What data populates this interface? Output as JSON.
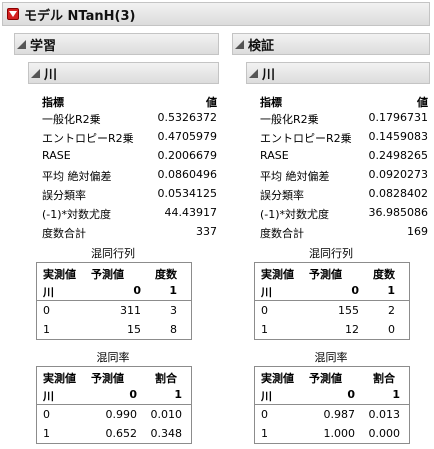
{
  "title": "モデル NTanH(3)",
  "panels": [
    {
      "section_label": "学習",
      "sub_label": "川",
      "stats_header": {
        "metric": "指標",
        "value": "値"
      },
      "stats": [
        {
          "label": "一般化R2乗",
          "value": "0.5326372"
        },
        {
          "label": "エントロピーR2乗",
          "value": "0.4705979"
        },
        {
          "label": "RASE",
          "value": "0.2006679"
        },
        {
          "label": "平均 絶対偏差",
          "value": "0.0860496"
        },
        {
          "label": "誤分類率",
          "value": "0.0534125"
        },
        {
          "label": "(-1)*対数尤度",
          "value": "44.43917"
        },
        {
          "label": "度数合計",
          "value": "337"
        }
      ],
      "confusion_matrix": {
        "caption": "混同行列",
        "header": [
          "実測値",
          "予測値",
          "度数"
        ],
        "var_label": "川",
        "classes": [
          "0",
          "1"
        ],
        "rows": [
          {
            "actual": "0",
            "values": [
              "311",
              "3"
            ]
          },
          {
            "actual": "1",
            "values": [
              "15",
              "8"
            ]
          }
        ]
      },
      "confusion_rates": {
        "caption": "混同率",
        "header": [
          "実測値",
          "予測値",
          "割合"
        ],
        "var_label": "川",
        "classes": [
          "0",
          "1"
        ],
        "rows": [
          {
            "actual": "0",
            "values": [
              "0.990",
              "0.010"
            ]
          },
          {
            "actual": "1",
            "values": [
              "0.652",
              "0.348"
            ]
          }
        ]
      }
    },
    {
      "section_label": "検証",
      "sub_label": "川",
      "stats_header": {
        "metric": "指標",
        "value": "値"
      },
      "stats": [
        {
          "label": "一般化R2乗",
          "value": "0.1796731"
        },
        {
          "label": "エントロピーR2乗",
          "value": "0.1459083"
        },
        {
          "label": "RASE",
          "value": "0.2498265"
        },
        {
          "label": "平均 絶対偏差",
          "value": "0.0920273"
        },
        {
          "label": "誤分類率",
          "value": "0.0828402"
        },
        {
          "label": "(-1)*対数尤度",
          "value": "36.985086"
        },
        {
          "label": "度数合計",
          "value": "169"
        }
      ],
      "confusion_matrix": {
        "caption": "混同行列",
        "header": [
          "実測値",
          "予測値",
          "度数"
        ],
        "var_label": "川",
        "classes": [
          "0",
          "1"
        ],
        "rows": [
          {
            "actual": "0",
            "values": [
              "155",
              "2"
            ]
          },
          {
            "actual": "1",
            "values": [
              "12",
              "0"
            ]
          }
        ]
      },
      "confusion_rates": {
        "caption": "混同率",
        "header": [
          "実測値",
          "予測値",
          "割合"
        ],
        "var_label": "川",
        "classes": [
          "0",
          "1"
        ],
        "rows": [
          {
            "actual": "0",
            "values": [
              "0.987",
              "0.013"
            ]
          },
          {
            "actual": "1",
            "values": [
              "1.000",
              "0.000"
            ]
          }
        ]
      }
    }
  ],
  "colors": {
    "accent": "#d42020",
    "header_bg": "#e4e4e4",
    "border": "#8c8c8c"
  }
}
